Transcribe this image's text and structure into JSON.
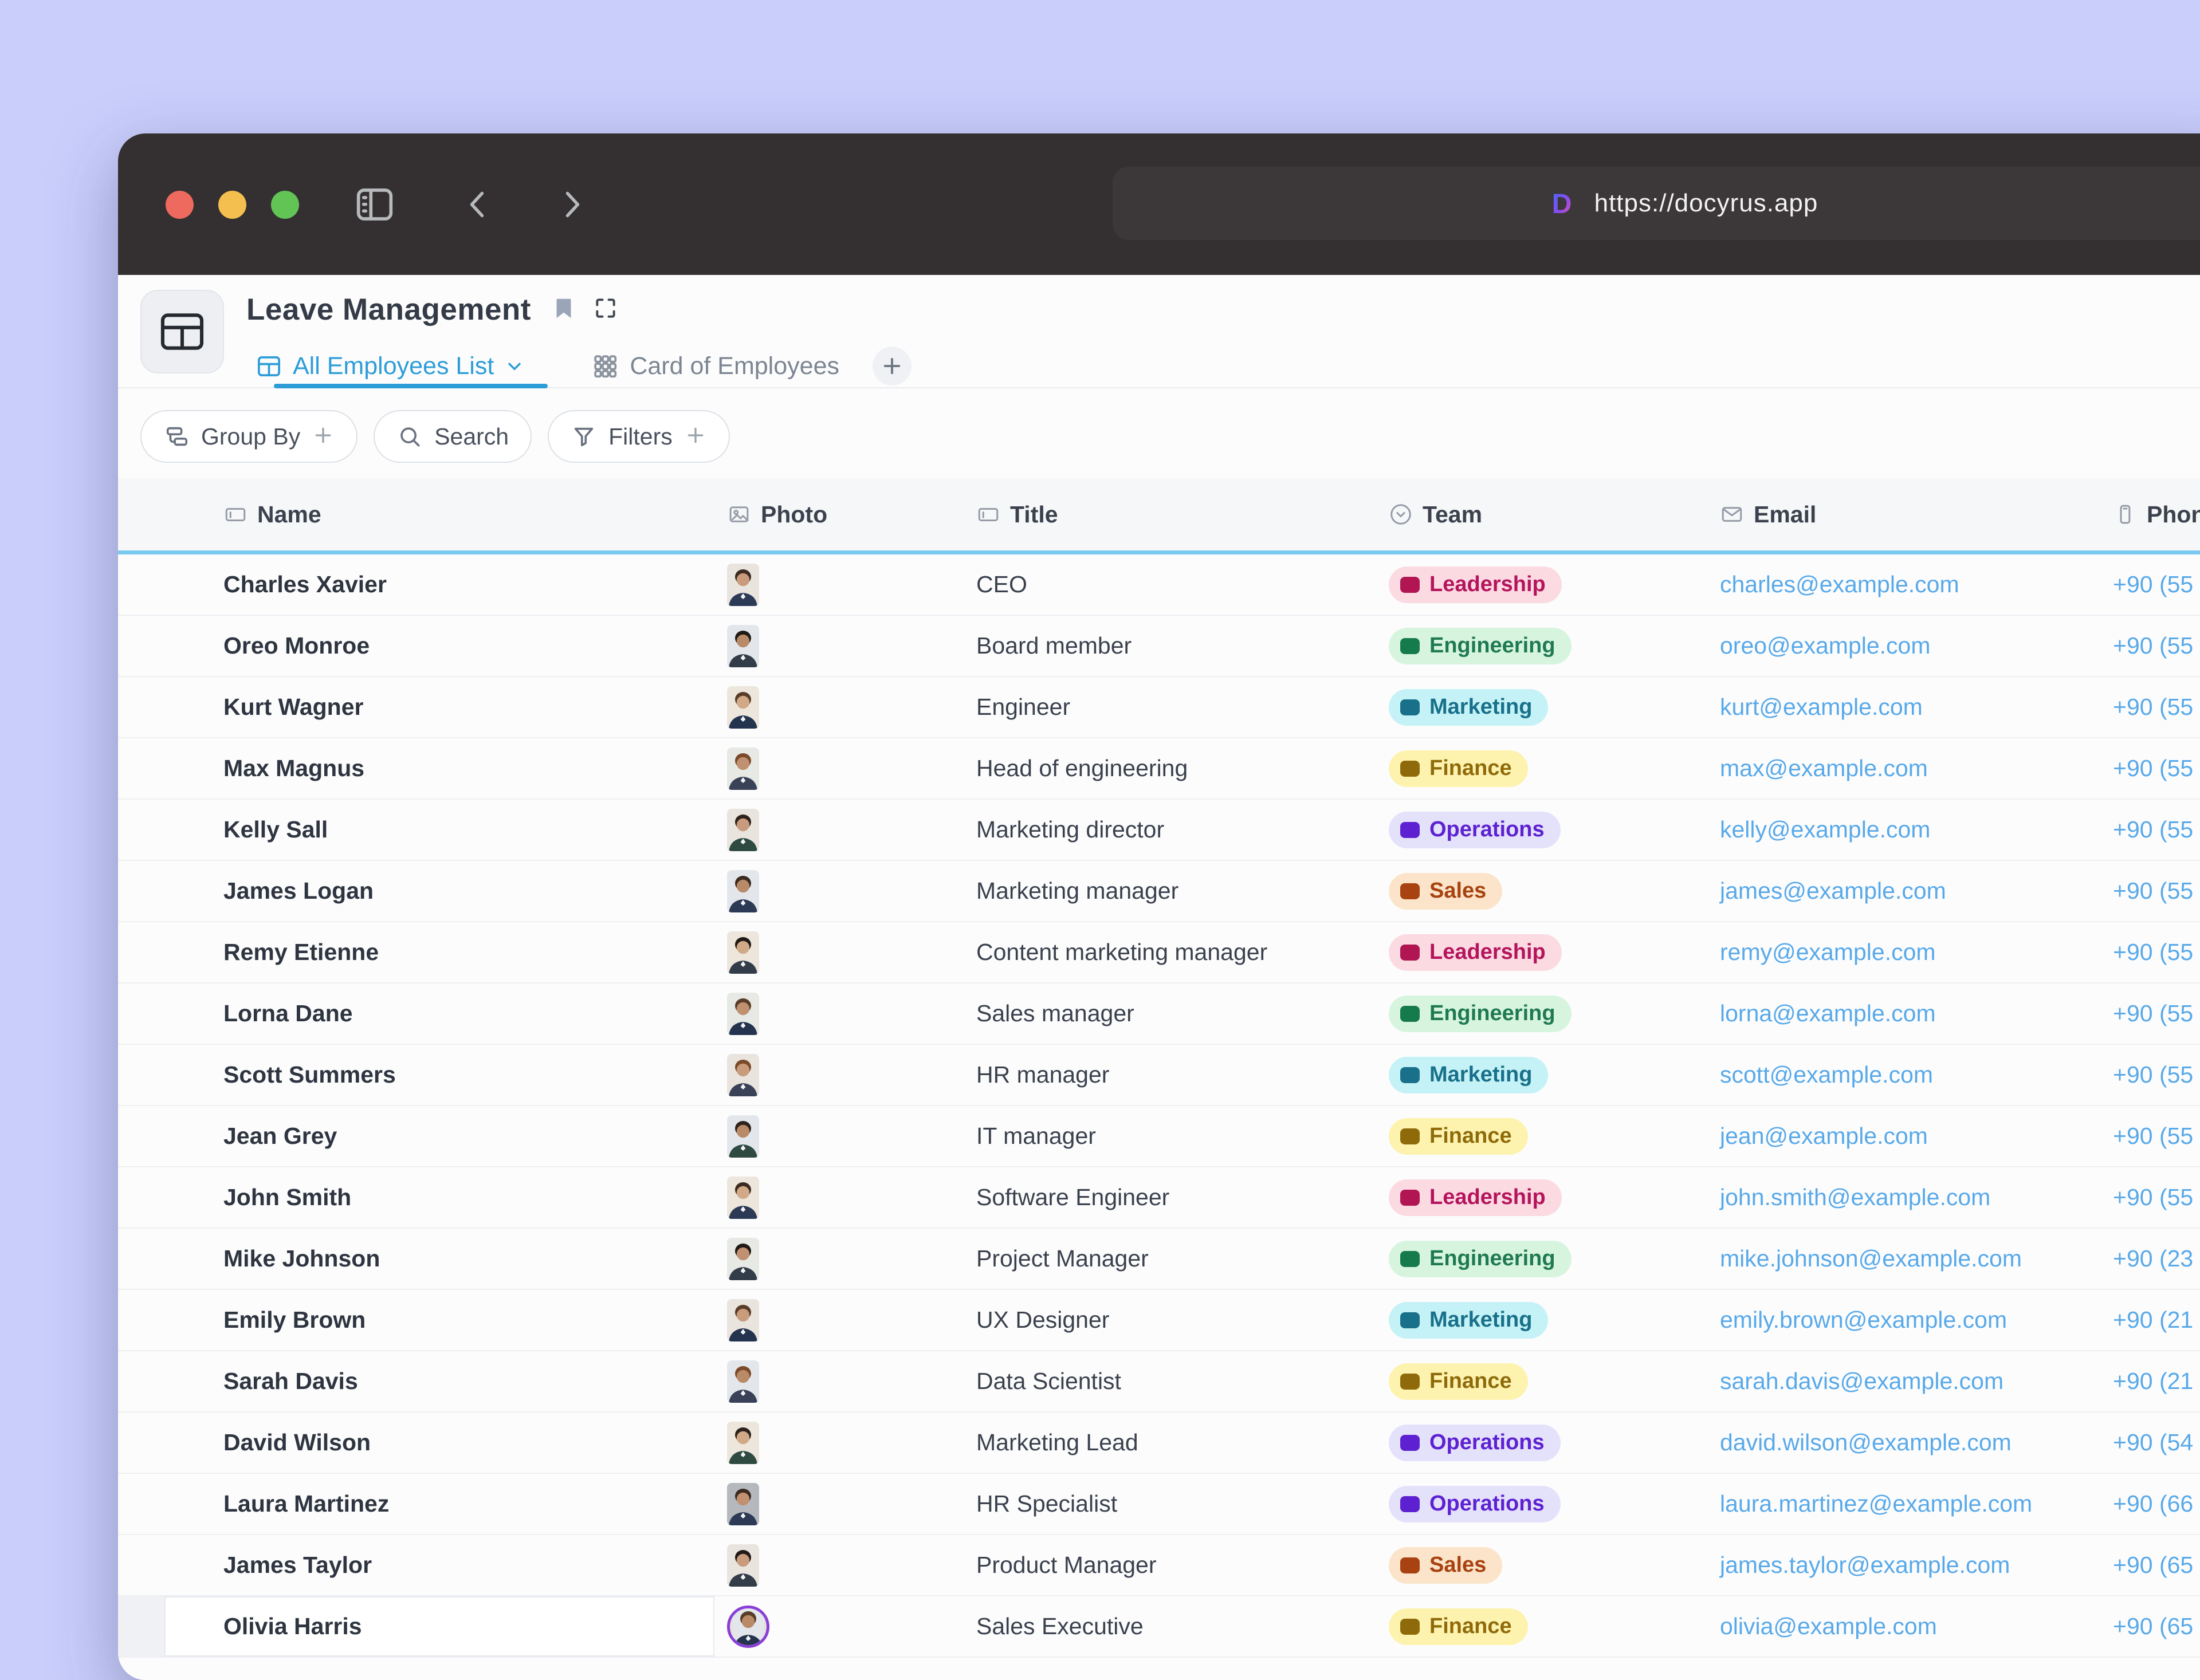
{
  "browser": {
    "url": "https://docyrus.app",
    "logo_letter": "D",
    "traffic_lights": {
      "close": "#ee6a5f",
      "minimize": "#f5bf4f",
      "zoom": "#61c455"
    }
  },
  "page": {
    "title": "Leave Management",
    "tabs": [
      {
        "label": "All Employees List",
        "active": true
      },
      {
        "label": "Card of Employees",
        "active": false
      }
    ],
    "toolbar": [
      {
        "label": "Group By",
        "plus": "+",
        "icon": "group-by-icon"
      },
      {
        "label": "Search",
        "plus": "",
        "icon": "search-icon"
      },
      {
        "label": "Filters",
        "plus": "+",
        "icon": "filter-icon"
      }
    ]
  },
  "colors": {
    "accent_blue": "#2d9dd8",
    "link_blue": "#58a9e9",
    "header_underline": "#79c9f1"
  },
  "table": {
    "columns": [
      {
        "label": "Name",
        "icon": "text-field-icon"
      },
      {
        "label": "Photo",
        "icon": "image-icon"
      },
      {
        "label": "Title",
        "icon": "text-field-icon"
      },
      {
        "label": "Team",
        "icon": "select-icon"
      },
      {
        "label": "Email",
        "icon": "email-icon"
      },
      {
        "label": "Phone",
        "icon": "phone-icon"
      }
    ],
    "teams": {
      "Leadership": {
        "bg": "#fbdae2",
        "swatch": "#b11552",
        "text": "#b5145c"
      },
      "Engineering": {
        "bg": "#d7f5de",
        "swatch": "#157a4c",
        "text": "#1f7a52"
      },
      "Marketing": {
        "bg": "#c4f2f6",
        "swatch": "#18708a",
        "text": "#18708a"
      },
      "Finance": {
        "bg": "#fdf3af",
        "swatch": "#8f6a0a",
        "text": "#8f6a0a"
      },
      "Operations": {
        "bg": "#e4e1fb",
        "swatch": "#5d21d2",
        "text": "#5d21d2"
      },
      "Sales": {
        "bg": "#fbe4c9",
        "swatch": "#a84210",
        "text": "#a84210"
      }
    },
    "rows": [
      {
        "name": "Charles Xavier",
        "title": "CEO",
        "team": "Leadership",
        "email": "charles@example.com",
        "phone": "+90 (55",
        "photo_style": "default"
      },
      {
        "name": "Oreo Monroe",
        "title": "Board member",
        "team": "Engineering",
        "email": "oreo@example.com",
        "phone": "+90 (55",
        "photo_style": "default"
      },
      {
        "name": "Kurt Wagner",
        "title": "Engineer",
        "team": "Marketing",
        "email": "kurt@example.com",
        "phone": "+90 (55",
        "photo_style": "default"
      },
      {
        "name": "Max Magnus",
        "title": "Head of engineering",
        "team": "Finance",
        "email": "max@example.com",
        "phone": "+90 (55",
        "photo_style": "default"
      },
      {
        "name": "Kelly Sall",
        "title": "Marketing director",
        "team": "Operations",
        "email": "kelly@example.com",
        "phone": "+90 (55",
        "photo_style": "default"
      },
      {
        "name": "James Logan",
        "title": "Marketing manager",
        "team": "Sales",
        "email": "james@example.com",
        "phone": "+90 (55",
        "photo_style": "default"
      },
      {
        "name": "Remy Etienne",
        "title": "Content marketing manager",
        "team": "Leadership",
        "email": "remy@example.com",
        "phone": "+90 (55",
        "photo_style": "default"
      },
      {
        "name": "Lorna Dane",
        "title": "Sales manager",
        "team": "Engineering",
        "email": "lorna@example.com",
        "phone": "+90 (55",
        "photo_style": "default"
      },
      {
        "name": "Scott Summers",
        "title": "HR manager",
        "team": "Marketing",
        "email": "scott@example.com",
        "phone": "+90 (55",
        "photo_style": "default"
      },
      {
        "name": "Jean Grey",
        "title": "IT manager",
        "team": "Finance",
        "email": "jean@example.com",
        "phone": "+90 (55",
        "photo_style": "default"
      },
      {
        "name": "John Smith",
        "title": "Software Engineer",
        "team": "Leadership",
        "email": "john.smith@example.com",
        "phone": "+90 (55",
        "photo_style": "default"
      },
      {
        "name": "Mike Johnson",
        "title": "Project Manager",
        "team": "Engineering",
        "email": "mike.johnson@example.com",
        "phone": "+90 (23",
        "photo_style": "default"
      },
      {
        "name": "Emily Brown",
        "title": "UX Designer",
        "team": "Marketing",
        "email": "emily.brown@example.com",
        "phone": "+90 (21",
        "photo_style": "default"
      },
      {
        "name": "Sarah Davis",
        "title": "Data Scientist",
        "team": "Finance",
        "email": "sarah.davis@example.com",
        "phone": "+90 (21",
        "photo_style": "default"
      },
      {
        "name": "David Wilson",
        "title": "Marketing Lead",
        "team": "Operations",
        "email": "david.wilson@example.com",
        "phone": "+90 (54",
        "photo_style": "default"
      },
      {
        "name": "Laura Martinez",
        "title": "HR Specialist",
        "team": "Operations",
        "email": "laura.martinez@example.com",
        "phone": "+90 (66",
        "photo_style": "gray-bg"
      },
      {
        "name": "James Taylor",
        "title": "Product Manager",
        "team": "Sales",
        "email": "james.taylor@example.com",
        "phone": "+90 (65",
        "photo_style": "default"
      },
      {
        "name": "Olivia Harris",
        "title": "Sales Executive",
        "team": "Finance",
        "email": "olivia@example.com",
        "phone": "+90 (65",
        "photo_style": "round-ring"
      }
    ]
  }
}
